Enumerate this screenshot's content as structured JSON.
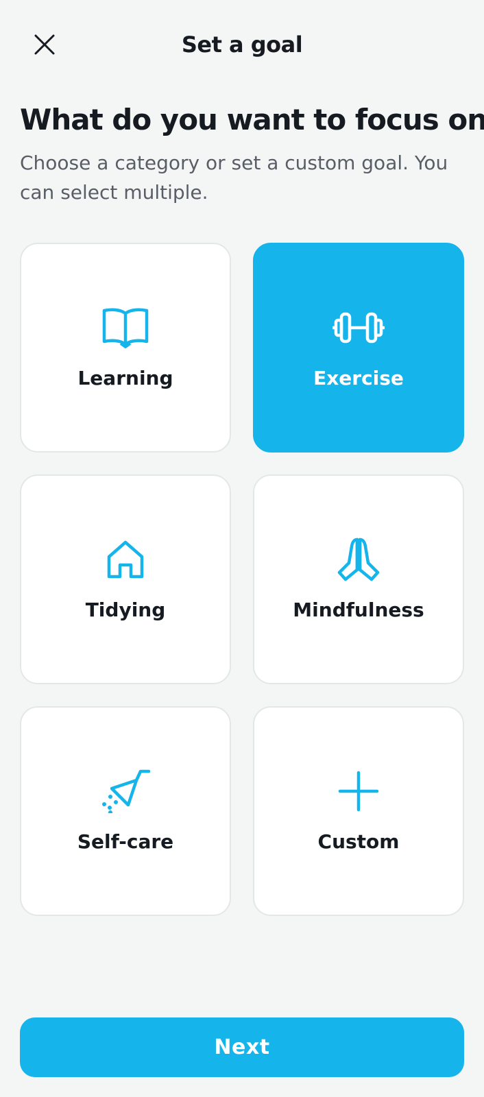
{
  "header": {
    "title": "Set a goal",
    "close_icon": "close-icon"
  },
  "main": {
    "heading": "What do you want to focus on?",
    "subheading": "Choose a category or set a custom goal. You can select multiple."
  },
  "categories": [
    {
      "label": "Learning",
      "icon": "book-icon",
      "selected": false
    },
    {
      "label": "Exercise",
      "icon": "dumbbell-icon",
      "selected": true
    },
    {
      "label": "Tidying",
      "icon": "house-icon",
      "selected": false
    },
    {
      "label": "Mindfulness",
      "icon": "praying-hands-icon",
      "selected": false
    },
    {
      "label": "Self-care",
      "icon": "shower-icon",
      "selected": false
    },
    {
      "label": "Custom",
      "icon": "plus-icon",
      "selected": false
    }
  ],
  "footer": {
    "next_label": "Next"
  },
  "colors": {
    "accent": "#15b4ea",
    "background": "#f4f5f5",
    "card_border": "#e4e7e9",
    "text_primary": "#161b22",
    "text_secondary": "#585e66"
  }
}
